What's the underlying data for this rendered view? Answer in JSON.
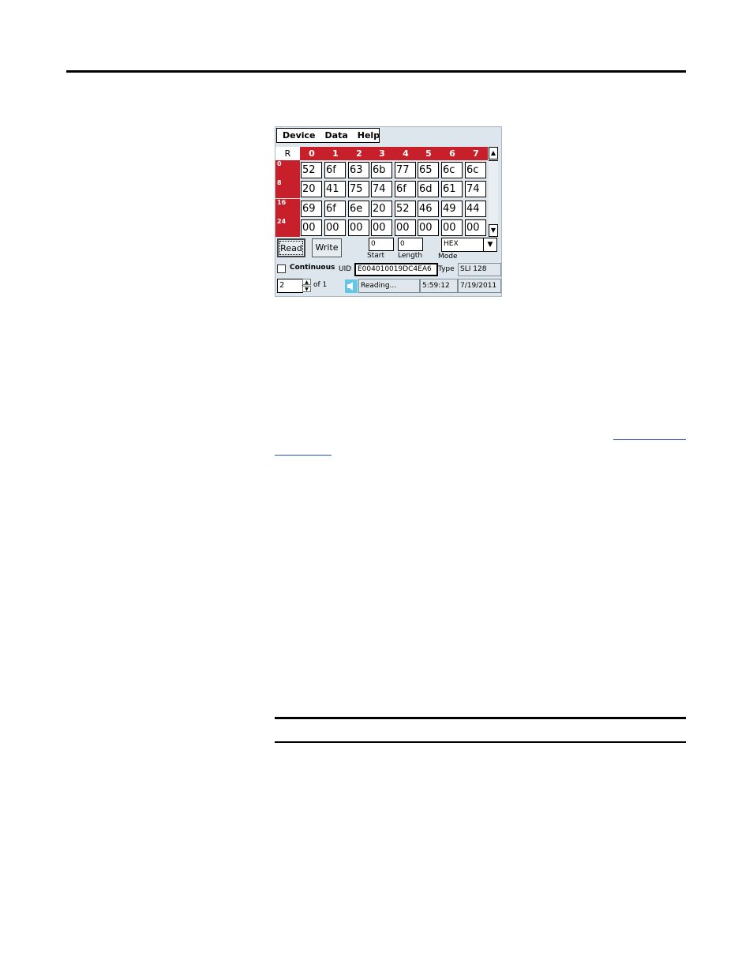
{
  "menu": [
    "Device",
    "Data",
    "Help"
  ],
  "grid": {
    "corner": "R",
    "columns": [
      "0",
      "1",
      "2",
      "3",
      "4",
      "5",
      "6",
      "7"
    ],
    "rows": [
      {
        "label": "0",
        "cells": [
          "52",
          "6f",
          "63",
          "6b",
          "77",
          "65",
          "6c",
          "6c"
        ]
      },
      {
        "label": "8",
        "cells": [
          "20",
          "41",
          "75",
          "74",
          "6f",
          "6d",
          "61",
          "74"
        ]
      },
      {
        "label": "16",
        "cells": [
          "69",
          "6f",
          "6e",
          "20",
          "52",
          "46",
          "49",
          "44"
        ]
      },
      {
        "label": "24",
        "cells": [
          "00",
          "00",
          "00",
          "00",
          "00",
          "00",
          "00",
          "00"
        ]
      }
    ]
  },
  "controls": {
    "read_label": "Read",
    "write_label": "Write",
    "start_value": "0",
    "start_label": "Start",
    "length_value": "0",
    "length_label": "Length",
    "mode_value": "HEX",
    "mode_label": "Mode",
    "continuous_label": "Continuous",
    "uid_label": "UID",
    "uid_value": "E004010019DC4EA6",
    "type_label": "Type",
    "type_value": "SLI 128"
  },
  "status": {
    "page_value": "2",
    "page_of": "of 1",
    "message": "Reading...",
    "time": "5:59:12",
    "date": "7/19/2011"
  },
  "icons": {
    "scroll_up": "scroll-up-icon",
    "scroll_down": "scroll-down-icon",
    "dropdown": "chevron-down-icon",
    "speaker": "speaker-icon"
  },
  "colors": {
    "header_red": "#c8202a",
    "app_bg": "#dce6ec",
    "link_blue": "#2d4fb8"
  }
}
